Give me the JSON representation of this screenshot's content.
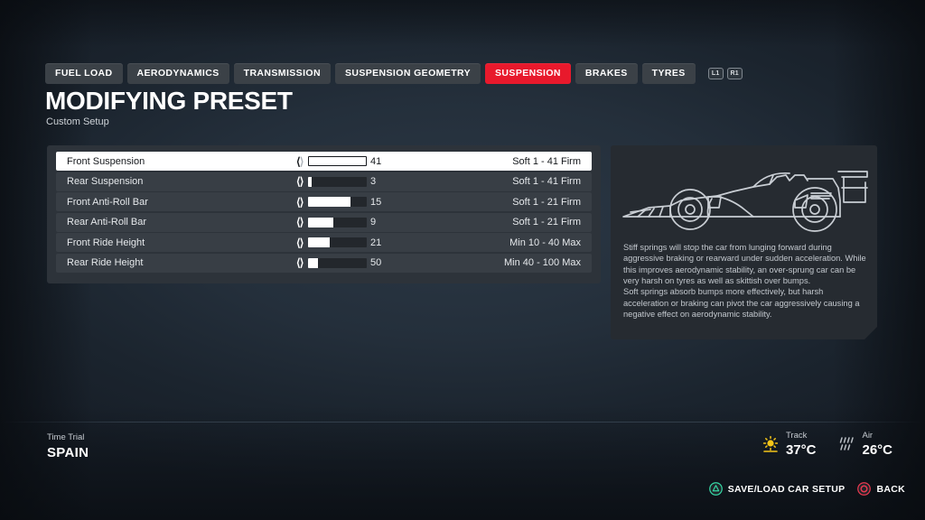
{
  "tabs": [
    {
      "label": "FUEL LOAD",
      "active": false
    },
    {
      "label": "AERODYNAMICS",
      "active": false
    },
    {
      "label": "TRANSMISSION",
      "active": false
    },
    {
      "label": "SUSPENSION GEOMETRY",
      "active": false
    },
    {
      "label": "SUSPENSION",
      "active": true
    },
    {
      "label": "BRAKES",
      "active": false
    },
    {
      "label": "TYRES",
      "active": false
    }
  ],
  "bumpers": [
    {
      "label": "L1"
    },
    {
      "label": "R1"
    }
  ],
  "header": {
    "title": "MODIFYING PRESET",
    "subtitle": "Custom Setup"
  },
  "settings": {
    "rows": [
      {
        "label": "Front Suspension",
        "value": "41",
        "range": "Soft 1 - 41 Firm",
        "fill_percent": 100,
        "selected": true,
        "left_arrow_enabled": true,
        "right_arrow_enabled": false
      },
      {
        "label": "Rear Suspension",
        "value": "3",
        "range": "Soft 1 - 41 Firm",
        "fill_percent": 6,
        "selected": false,
        "left_arrow_enabled": true,
        "right_arrow_enabled": true
      },
      {
        "label": "Front Anti-Roll Bar",
        "value": "15",
        "range": "Soft 1 - 21 Firm",
        "fill_percent": 71,
        "selected": false,
        "left_arrow_enabled": true,
        "right_arrow_enabled": true
      },
      {
        "label": "Rear Anti-Roll Bar",
        "value": "9",
        "range": "Soft 1 - 21 Firm",
        "fill_percent": 43,
        "selected": false,
        "left_arrow_enabled": true,
        "right_arrow_enabled": true
      },
      {
        "label": "Front Ride Height",
        "value": "21",
        "range": "Min 10 - 40 Max",
        "fill_percent": 37,
        "selected": false,
        "left_arrow_enabled": true,
        "right_arrow_enabled": true
      },
      {
        "label": "Rear Ride Height",
        "value": "50",
        "range": "Min 40 - 100 Max",
        "fill_percent": 17,
        "selected": false,
        "left_arrow_enabled": true,
        "right_arrow_enabled": true
      }
    ]
  },
  "info": {
    "paragraph1": "Stiff springs will stop the car from lunging forward during aggressive braking or rearward under sudden acceleration. While this improves aerodynamic stability, an over-sprung car can be very harsh on tyres as well as skittish over bumps.",
    "paragraph2": "Soft springs absorb bumps more effectively, but harsh acceleration or braking can pivot the car aggressively causing a negative effect on aerodynamic stability."
  },
  "footer": {
    "mode": "Time Trial",
    "track": "SPAIN",
    "weather": [
      {
        "label": "Track",
        "value": "37°C",
        "icon": "sun-icon",
        "color": "#f5c518"
      },
      {
        "label": "Air",
        "value": "26°C",
        "icon": "drizzle-icon",
        "color": "#b9bec4"
      }
    ]
  },
  "actions": [
    {
      "label": "SAVE/LOAD CAR SETUP",
      "icon": "ps-triangle-icon",
      "color": "#35d6a4"
    },
    {
      "label": "BACK",
      "icon": "ps-circle-icon",
      "color": "#e8384f"
    }
  ],
  "colors": {
    "accent_red": "#e8192c",
    "panel": "#2d333a",
    "row": "#383e45",
    "selected_row": "#ffffff"
  }
}
